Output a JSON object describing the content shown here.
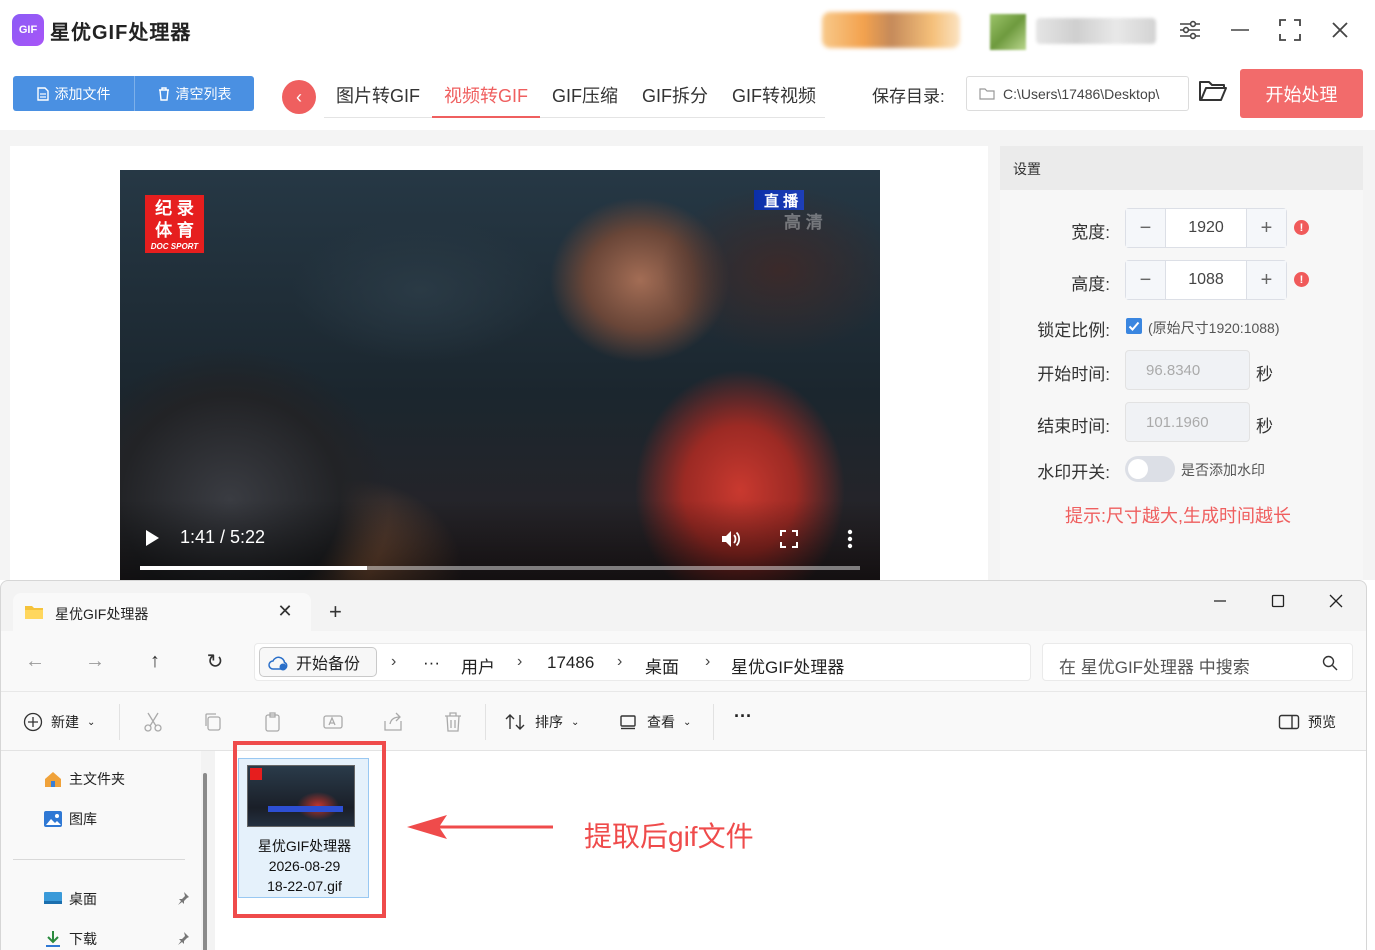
{
  "app": {
    "logo_text": "GIF",
    "title": "星优GIF处理器"
  },
  "toolbar": {
    "add_file": "添加文件",
    "clear_list": "清空列表",
    "tabs": [
      "图片转GIF",
      "视频转GIF",
      "GIF压缩",
      "GIF拆分",
      "GIF转视频"
    ],
    "active_tab": "视频转GIF",
    "save_label": "保存目录:",
    "save_path": "C:\\Users\\17486\\Desktop\\",
    "start": "开始处理"
  },
  "video": {
    "logo_line1": "纪 录",
    "logo_line2": "体 育",
    "logo_sub": "DOC SPORT",
    "live_badge": "直 播",
    "hd_mark": "高 清",
    "time": "1:41 / 5:22",
    "progress": 0.315
  },
  "settings": {
    "header": "设置",
    "width_label": "宽度:",
    "width_value": "1920",
    "height_label": "高度:",
    "height_value": "1088",
    "lock_label": "锁定比例:",
    "lock_checked": true,
    "lock_text": "(原始尺寸1920:1088)",
    "start_label": "开始时间:",
    "start_value": "96.8340",
    "end_label": "结束时间:",
    "end_value": "101.1960",
    "sec_unit": "秒",
    "watermark_label": "水印开关:",
    "watermark_on": false,
    "watermark_text": "是否添加水印",
    "tip": "提示:尺寸越大,生成时间越长",
    "colors": {
      "accent": "#ef5f5f",
      "blue": "#4a90e2"
    }
  },
  "explorer": {
    "tab_title": "星优GIF处理器",
    "backup": "开始备份",
    "breadcrumbs": [
      "···",
      "用户",
      "17486",
      "桌面",
      "星优GIF处理器"
    ],
    "search_placeholder": "在 星优GIF处理器 中搜索",
    "cmd": {
      "new": "新建",
      "sort": "排序",
      "view": "查看",
      "more": "···",
      "preview": "预览"
    },
    "sidebar": [
      "主文件夹",
      "图库",
      "桌面",
      "下载"
    ],
    "file": {
      "name_line1": "星优GIF处理器",
      "name_line2": "2026-08-29",
      "name_line3": "18-22-07.gif"
    }
  },
  "annotation": {
    "text": "提取后gif文件",
    "color": "#ef4b4b"
  }
}
